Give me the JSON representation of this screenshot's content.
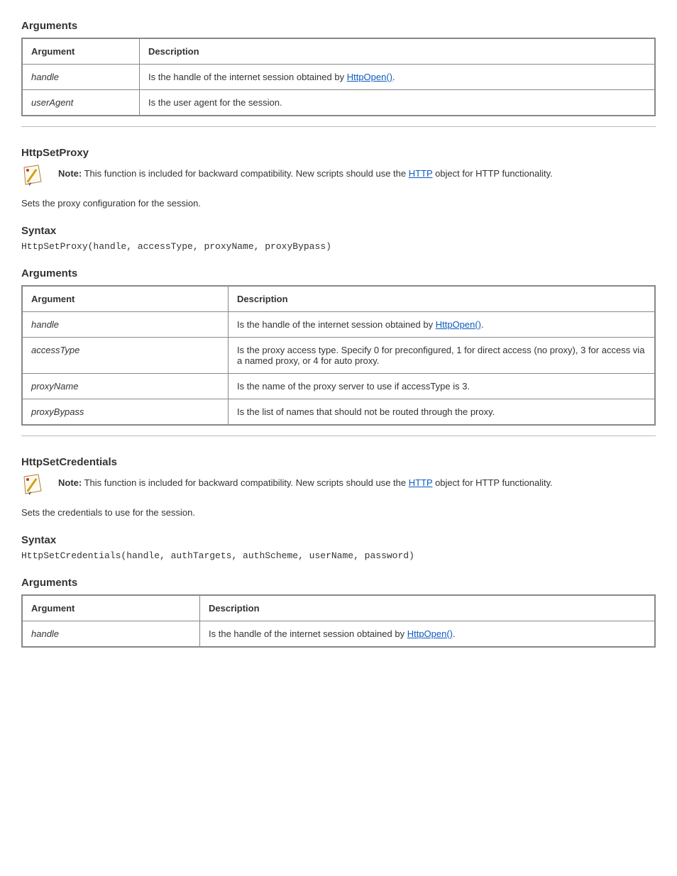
{
  "fn1": {
    "tableHeaders": {
      "arg": "Argument",
      "desc": "Description"
    },
    "rows": [
      {
        "arg": "handle",
        "desc_pre": "Is the handle of the internet session obtained by ",
        "link": "HttpOpen()",
        "desc_post": "."
      },
      {
        "arg": "userAgent",
        "desc": "Is the user agent for the session."
      }
    ]
  },
  "fn2": {
    "name": "HttpSetProxy",
    "noteLead": "Note:",
    "noteText": "This function is included for backward compatibility. New scripts should use the ",
    "noteLink": "HTTP",
    "noteTrail": " object for HTTP functionality.",
    "desc": "Sets the proxy configuration for the session.",
    "syntaxLabel": "Syntax",
    "syntax": "HttpSetProxy(handle, accessType, proxyName, proxyBypass)",
    "argsLabel": "Arguments",
    "tableHeaders": {
      "arg": "Argument",
      "desc": "Description"
    },
    "rows": [
      {
        "arg": "handle",
        "desc_pre": "Is the handle of the internet session obtained by ",
        "link": "HttpOpen()",
        "desc_post": "."
      },
      {
        "arg": "accessType",
        "desc": "Is the proxy access type. Specify 0 for preconfigured, 1 for direct access (no proxy), 3 for access via a named proxy, or 4 for auto proxy."
      },
      {
        "arg": "proxyName",
        "desc": "Is the name of the proxy server to use if accessType is 3."
      },
      {
        "arg": "proxyBypass",
        "desc": "Is the list of names that should not be routed through the proxy."
      }
    ]
  },
  "fn3": {
    "name": "HttpSetCredentials",
    "noteLead": "Note:",
    "noteText": "This function is included for backward compatibility. New scripts should use the ",
    "noteLink": "HTTP",
    "noteTrail": " object for HTTP functionality.",
    "desc": "Sets the credentials to use for the session.",
    "syntaxLabel": "Syntax",
    "syntax": "HttpSetCredentials(handle, authTargets, authScheme, userName, password)",
    "argsLabel": "Arguments",
    "tableHeaders": {
      "arg": "Argument",
      "desc": "Description"
    },
    "rows": [
      {
        "arg": "handle",
        "desc_pre": "Is the handle of the internet session obtained by ",
        "link": "HttpOpen()",
        "desc_post": "."
      }
    ]
  }
}
